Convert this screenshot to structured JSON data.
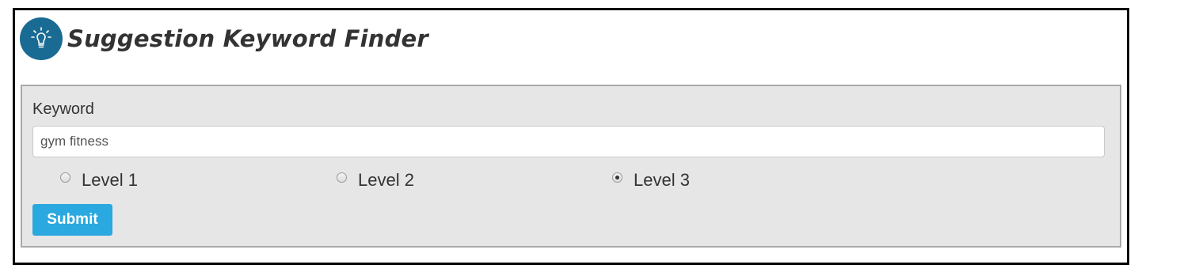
{
  "header": {
    "icon": "lightbulb-icon",
    "title": "Suggestion Keyword Finder",
    "logo_color": "#1a6b94"
  },
  "form": {
    "keyword_label": "Keyword",
    "keyword_value": "gym fitness",
    "levels": [
      {
        "label": "Level 1",
        "checked": false
      },
      {
        "label": "Level 2",
        "checked": false
      },
      {
        "label": "Level 3",
        "checked": true
      }
    ],
    "submit_label": "Submit",
    "submit_color": "#2aa8e0"
  }
}
